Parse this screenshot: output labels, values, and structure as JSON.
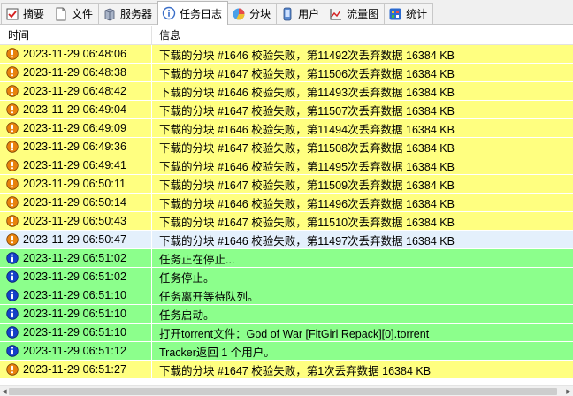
{
  "tabs": [
    {
      "label": "摘要",
      "icon": "summary-icon"
    },
    {
      "label": "文件",
      "icon": "files-icon"
    },
    {
      "label": "服务器",
      "icon": "server-icon"
    },
    {
      "label": "任务日志",
      "icon": "task-log-icon",
      "active": true
    },
    {
      "label": "分块",
      "icon": "pieces-icon"
    },
    {
      "label": "用户",
      "icon": "users-icon"
    },
    {
      "label": "流量图",
      "icon": "traffic-graph-icon"
    },
    {
      "label": "统计",
      "icon": "statistics-icon"
    }
  ],
  "table": {
    "columns": {
      "time": "时间",
      "info": "信息"
    },
    "rows": [
      {
        "level": "warn",
        "time": "2023-11-29 06:48:06",
        "message": "下载的分块 #1646 校验失败，第11492次丢弃数据 16384 KB"
      },
      {
        "level": "warn",
        "time": "2023-11-29 06:48:38",
        "message": "下载的分块 #1647 校验失败，第11506次丢弃数据 16384 KB"
      },
      {
        "level": "warn",
        "time": "2023-11-29 06:48:42",
        "message": "下载的分块 #1646 校验失败，第11493次丢弃数据 16384 KB"
      },
      {
        "level": "warn",
        "time": "2023-11-29 06:49:04",
        "message": "下载的分块 #1647 校验失败，第11507次丢弃数据 16384 KB"
      },
      {
        "level": "warn",
        "time": "2023-11-29 06:49:09",
        "message": "下载的分块 #1646 校验失败，第11494次丢弃数据 16384 KB"
      },
      {
        "level": "warn",
        "time": "2023-11-29 06:49:36",
        "message": "下载的分块 #1647 校验失败，第11508次丢弃数据 16384 KB"
      },
      {
        "level": "warn",
        "time": "2023-11-29 06:49:41",
        "message": "下载的分块 #1646 校验失败，第11495次丢弃数据 16384 KB"
      },
      {
        "level": "warn",
        "time": "2023-11-29 06:50:11",
        "message": "下载的分块 #1647 校验失败，第11509次丢弃数据 16384 KB"
      },
      {
        "level": "warn",
        "time": "2023-11-29 06:50:14",
        "message": "下载的分块 #1646 校验失败，第11496次丢弃数据 16384 KB"
      },
      {
        "level": "warn",
        "time": "2023-11-29 06:50:43",
        "message": "下载的分块 #1647 校验失败，第11510次丢弃数据 16384 KB"
      },
      {
        "level": "warn",
        "time": "2023-11-29 06:50:47",
        "message": "下载的分块 #1646 校验失败，第11497次丢弃数据 16384 KB",
        "selected": true
      },
      {
        "level": "info",
        "time": "2023-11-29 06:51:02",
        "message": "任务正在停止..."
      },
      {
        "level": "info",
        "time": "2023-11-29 06:51:02",
        "message": "任务停止。"
      },
      {
        "level": "info",
        "time": "2023-11-29 06:51:10",
        "message": "任务离开等待队列。"
      },
      {
        "level": "info",
        "time": "2023-11-29 06:51:10",
        "message": "任务启动。"
      },
      {
        "level": "info",
        "time": "2023-11-29 06:51:10",
        "message": "打开torrent文件：God of War [FitGirl Repack][0].torrent"
      },
      {
        "level": "info",
        "time": "2023-11-29 06:51:12",
        "message": "Tracker返回 1 个用户。"
      },
      {
        "level": "warn",
        "time": "2023-11-29 06:51:27",
        "message": "下载的分块 #1647 校验失败，第1次丢弃数据 16384 KB"
      }
    ]
  },
  "colors": {
    "warn_row": "#ffff80",
    "info_row": "#8cff8c",
    "selected_row": "#e4f0fc",
    "warn_icon": "#e8820c",
    "info_icon": "#1440c8"
  }
}
